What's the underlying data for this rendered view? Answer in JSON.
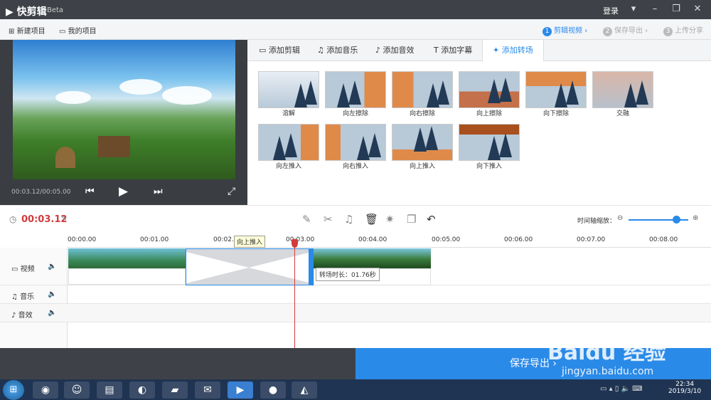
{
  "titlebar": {
    "app_name": "快剪辑",
    "beta": "Beta",
    "login": "登录",
    "menu_icon": "menu-icon",
    "min_icon": "minimize-icon",
    "max_icon": "maximize-icon",
    "close_icon": "close-icon"
  },
  "toolbar": {
    "new_project": "新建项目",
    "my_projects": "我的项目"
  },
  "steps": [
    {
      "num": "1",
      "label": "剪辑视频",
      "active": true
    },
    {
      "num": "2",
      "label": "保存导出",
      "active": false
    },
    {
      "num": "3",
      "label": "上传分享",
      "active": false
    }
  ],
  "preview": {
    "timecode": "00:03.12/00:05.00"
  },
  "tabs": [
    "添加剪辑",
    "添加音乐",
    "添加音效",
    "添加字幕",
    "添加转场"
  ],
  "active_tab": "添加转场",
  "transitions": [
    "溶解",
    "向左擦除",
    "向右擦除",
    "向上擦除",
    "向下擦除",
    "交融",
    "向左推入",
    "向右推入",
    "向上推入",
    "向下推入"
  ],
  "timeline": {
    "current_time": "00:03.12",
    "zoom_label": "时间轴缩放：",
    "zoom_level": 0.8,
    "ticks": [
      "00:00.00",
      "00:01.00",
      "00:02.0",
      "00:03.00",
      "00:04.00",
      "00:05.00",
      "00:06.00",
      "00:07.00",
      "00:08.00"
    ],
    "tooltip": "向上推入",
    "duration_label": "转场时长：01.76秒"
  },
  "tracks": [
    "视频",
    "音乐",
    "音效"
  ],
  "export": {
    "label": "保存导出 ›"
  },
  "taskbar": {
    "time": "22:34",
    "date": "2019/3/10"
  },
  "watermark": {
    "brand": "Baidu 经验",
    "url": "jingyan.baidu.com"
  }
}
